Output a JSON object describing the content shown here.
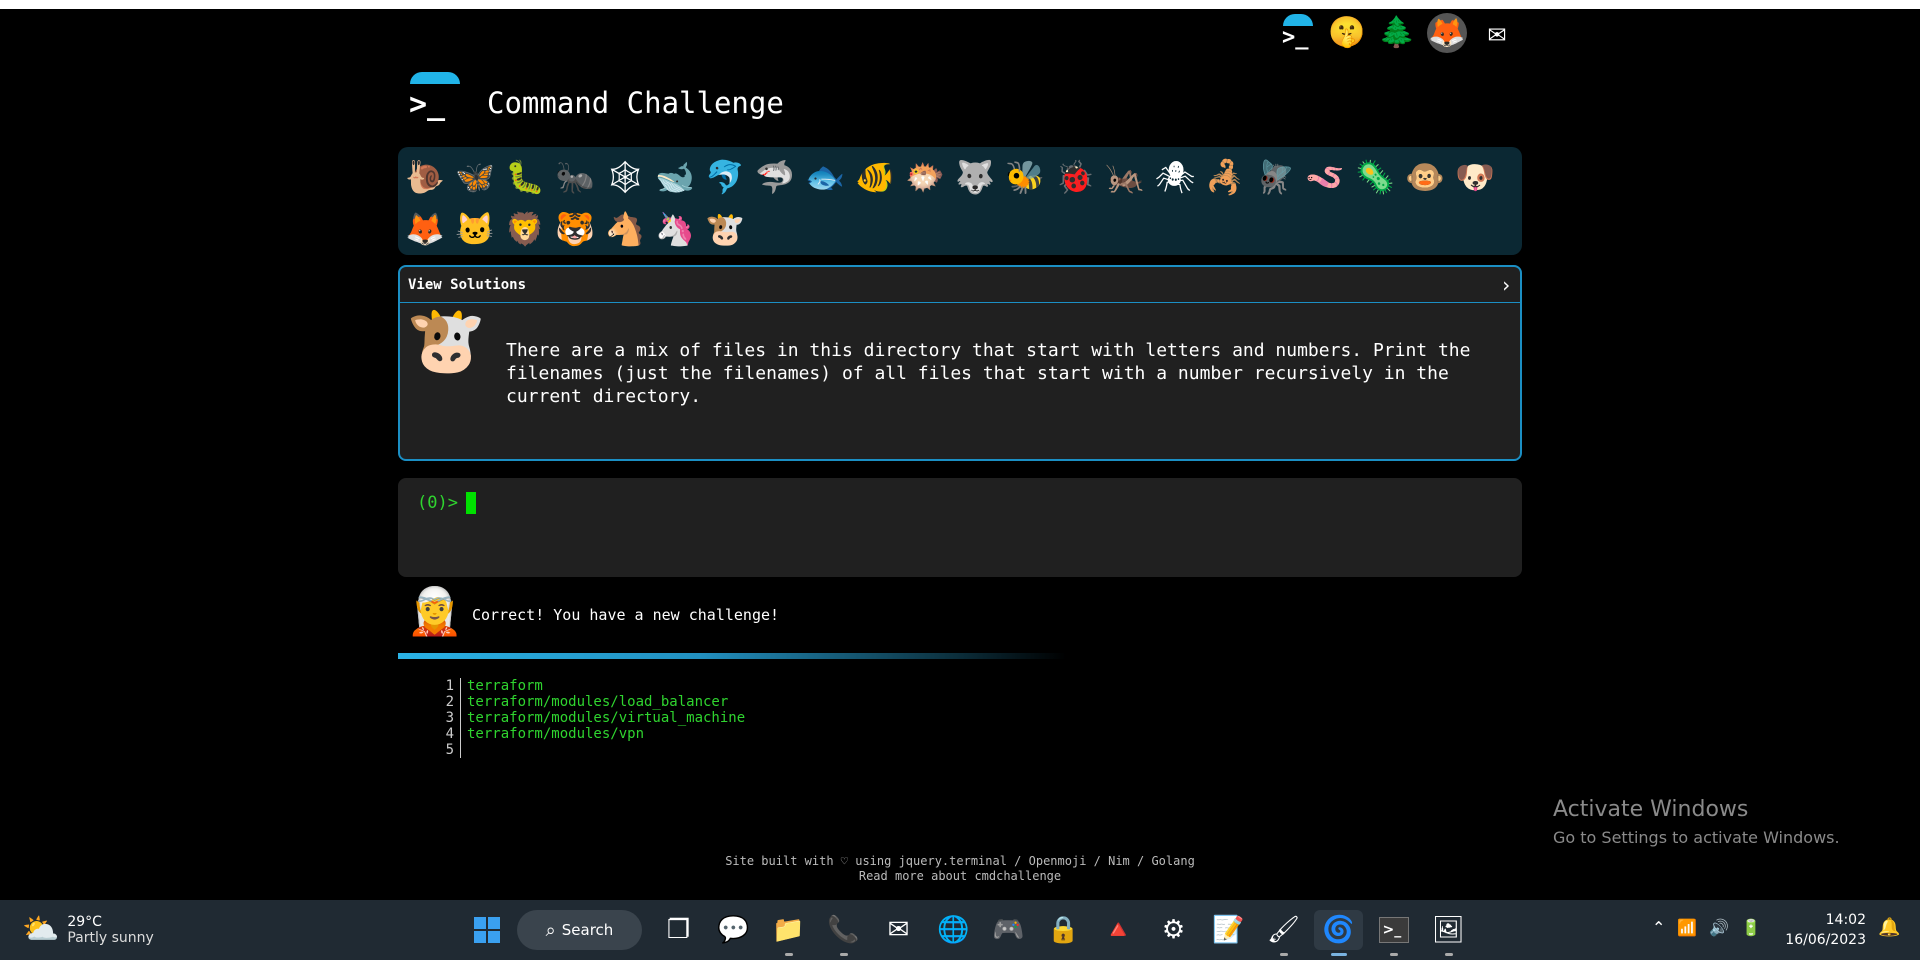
{
  "header": {
    "title": "Command Challenge",
    "logo_glyph": ">_"
  },
  "top_icons": [
    {
      "name": "terminal-logo-icon",
      "glyph": ">_"
    },
    {
      "name": "shushing-face-icon",
      "glyph": "🤫"
    },
    {
      "name": "tree-icon",
      "glyph": "🌲"
    },
    {
      "name": "gitlab-fox-icon",
      "glyph": "🦊"
    },
    {
      "name": "mail-icon",
      "glyph": "✉"
    }
  ],
  "animals": [
    {
      "name": "snail-icon",
      "glyph": "🐌"
    },
    {
      "name": "butterfly-icon",
      "glyph": "🦋"
    },
    {
      "name": "caterpillar-icon",
      "glyph": "🐛"
    },
    {
      "name": "ant-icon",
      "glyph": "🐜"
    },
    {
      "name": "cobweb-icon",
      "glyph": "🕸"
    },
    {
      "name": "whale-icon",
      "glyph": "🐋"
    },
    {
      "name": "dolphin-icon",
      "glyph": "🐬"
    },
    {
      "name": "shark-icon",
      "glyph": "🦈"
    },
    {
      "name": "fish-icon",
      "glyph": "🐟"
    },
    {
      "name": "tropical-fish-icon",
      "glyph": "🐠"
    },
    {
      "name": "blowfish-icon",
      "glyph": "🐡"
    },
    {
      "name": "wolf-icon",
      "glyph": "🐺"
    },
    {
      "name": "bee-icon",
      "glyph": "🐝"
    },
    {
      "name": "ladybug-icon",
      "glyph": "🐞"
    },
    {
      "name": "cricket-icon",
      "glyph": "🦗"
    },
    {
      "name": "spider-icon",
      "glyph": "🕷"
    },
    {
      "name": "scorpion-icon",
      "glyph": "🦂"
    },
    {
      "name": "fly-icon",
      "glyph": "🪰"
    },
    {
      "name": "worm-icon",
      "glyph": "🪱"
    },
    {
      "name": "microbe-icon",
      "glyph": "🦠"
    },
    {
      "name": "monkey-icon",
      "glyph": "🐵"
    },
    {
      "name": "dog-icon",
      "glyph": "🐶"
    },
    {
      "name": "fox-icon",
      "glyph": "🦊"
    },
    {
      "name": "cat-icon",
      "glyph": "🐱"
    },
    {
      "name": "lion-icon",
      "glyph": "🦁"
    },
    {
      "name": "tiger-icon",
      "glyph": "🐯"
    },
    {
      "name": "horse-icon",
      "glyph": "🐴"
    },
    {
      "name": "unicorn-icon",
      "glyph": "🦄"
    },
    {
      "name": "cow-icon",
      "glyph": "🐮"
    }
  ],
  "challenge": {
    "view_solutions": "View Solutions",
    "chevron": "›",
    "avatar_glyph": "🐮",
    "text": "There are a mix of files in this directory that start with letters and numbers. Print the filenames (just the filenames) of all files that start with a number recursively in the current directory."
  },
  "terminal": {
    "prompt": "(0)>"
  },
  "message": {
    "avatar_glyph": "🧝",
    "text": "Correct! You have a new challenge!",
    "progress_fraction": 0.45
  },
  "output": {
    "lines": [
      {
        "num": "1",
        "text": "terraform"
      },
      {
        "num": "2",
        "text": "terraform/modules/load_balancer"
      },
      {
        "num": "3",
        "text": "terraform/modules/virtual_machine"
      },
      {
        "num": "4",
        "text": "terraform/modules/vpn"
      },
      {
        "num": "5",
        "text": ""
      }
    ]
  },
  "footer": {
    "line1": "Site built with ♡ using jquery.terminal / Openmoji / Nim / Golang",
    "line2": "Read more about cmdchallenge"
  },
  "watermark": {
    "title": "Activate Windows",
    "subtitle": "Go to Settings to activate Windows."
  },
  "taskbar": {
    "weather": {
      "icon": "⛅",
      "temp": "29°C",
      "desc": "Partly sunny"
    },
    "search_label": "Search",
    "apps": [
      {
        "name": "task-view-icon",
        "glyph": "❐"
      },
      {
        "name": "teams-chat-icon",
        "glyph": "💬"
      },
      {
        "name": "file-explorer-icon",
        "glyph": "📁"
      },
      {
        "name": "whatsapp-icon",
        "glyph": "📞"
      },
      {
        "name": "mail-app-icon",
        "glyph": "✉"
      },
      {
        "name": "globe-app-icon",
        "glyph": "🌐"
      },
      {
        "name": "game-controller-icon",
        "glyph": "🎮"
      },
      {
        "name": "password-manager-icon",
        "glyph": "🔒"
      },
      {
        "name": "vlc-icon",
        "glyph": "🔺"
      },
      {
        "name": "settings-app-icon",
        "glyph": "⚙"
      },
      {
        "name": "notepad-icon",
        "glyph": "📝"
      },
      {
        "name": "paint-icon",
        "glyph": "🖌"
      },
      {
        "name": "edge-browser-icon",
        "glyph": "🌀"
      },
      {
        "name": "terminal-app-icon",
        "glyph": ">_"
      },
      {
        "name": "photos-app-icon",
        "glyph": "🖼"
      }
    ],
    "tray": {
      "chevron": "⌃",
      "wifi": "📶",
      "volume": "🔊",
      "battery": "🔋"
    },
    "time": "14:02",
    "date": "16/06/2023",
    "bell": "🔔"
  }
}
